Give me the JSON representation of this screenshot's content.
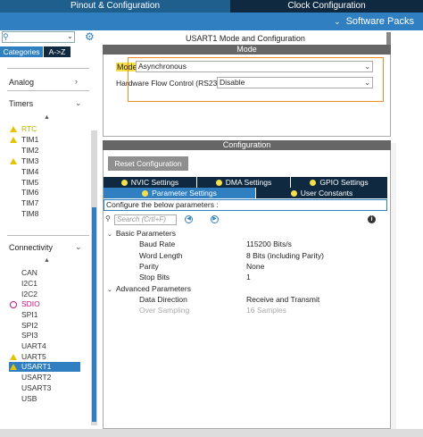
{
  "top_tabs": {
    "pinout": "Pinout & Configuration",
    "clock": "Clock Configuration"
  },
  "software_packs": {
    "chevron": "✔",
    "label": "Software Packs"
  },
  "left": {
    "search_icon": "search-icon",
    "tabs": {
      "categories": "Categories",
      "az": "A->Z"
    },
    "sections": {
      "analog": "Analog",
      "timers": "Timers",
      "connectivity": "Connectivity"
    },
    "timers": [
      "RTC",
      "TIM1",
      "TIM2",
      "TIM3",
      "TIM4",
      "TIM5",
      "TIM6",
      "TIM7",
      "TIM8"
    ],
    "connectivity": [
      "CAN",
      "I2C1",
      "I2C2",
      "SDIO",
      "SPI1",
      "SPI2",
      "SPI3",
      "UART4",
      "UART5",
      "USART1",
      "USART2",
      "USART3",
      "USB"
    ]
  },
  "main": {
    "title": "USART1 Mode and Configuration",
    "mode_bar": "Mode",
    "mode_label": "Mode",
    "mode_value": "Asynchronous",
    "hfc_label": "Hardware Flow Control (RS232)",
    "hfc_value": "Disable",
    "configuration_bar": "Configuration",
    "reset_button": "Reset Configuration",
    "tabs": [
      "NVIC Settings",
      "DMA Settings",
      "GPIO Settings",
      "Parameter Settings",
      "User Constants"
    ],
    "configure_text": "Configure the below parameters :",
    "search_placeholder": "Search (Crtl+F)",
    "groups": {
      "basic": "Basic Parameters",
      "advanced": "Advanced Parameters"
    },
    "basic_params": [
      {
        "name": "Baud Rate",
        "value": "115200 Bits/s"
      },
      {
        "name": "Word Length",
        "value": "8 Bits (including Parity)"
      },
      {
        "name": "Parity",
        "value": "None"
      },
      {
        "name": "Stop Bits",
        "value": "1"
      }
    ],
    "advanced_params": [
      {
        "name": "Data Direction",
        "value": "Receive and Transmit"
      },
      {
        "name": "Over Sampling",
        "value": "16 Samples"
      }
    ]
  },
  "colors": {
    "accent": "#2f7fc1",
    "dark": "#0f2a40",
    "warning": "#e6c300",
    "highlight": "#f08a1c"
  }
}
